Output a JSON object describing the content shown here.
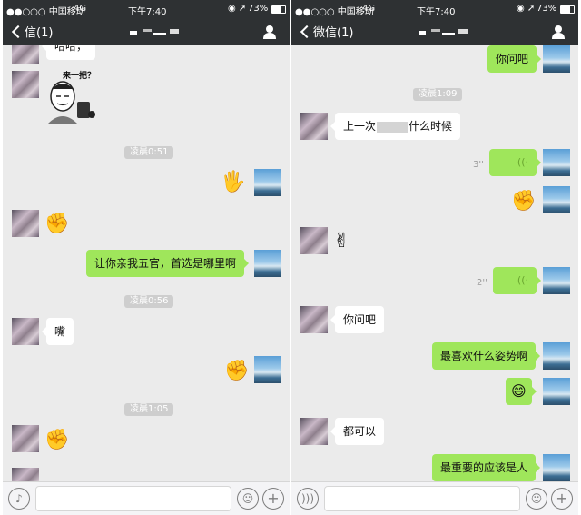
{
  "status": {
    "carrier": "●●○○○ 中国移动",
    "network": "4G",
    "time": "下午7:40",
    "battery": "73%"
  },
  "left": {
    "nav": {
      "back_label": "信(1)"
    },
    "sticker_caption": "来一把？",
    "top_partial_text": "哈哈，",
    "timestamps": [
      "凌晨0:51",
      "凌晨0:56",
      "凌晨1:05"
    ],
    "messages": {
      "m1": "让你亲我五官，首选是哪里啊",
      "m2": "嘴"
    },
    "emojis": {
      "wave": "🖐",
      "fist": "✊"
    }
  },
  "right": {
    "nav": {
      "back_label": "微信(1)"
    },
    "timestamps": [
      "凌晨1:09"
    ],
    "messages": {
      "m0": "你问吧",
      "m1": "上一次",
      "m1_tail": "什么时候",
      "m2": "你问吧",
      "m3": "最喜欢什么姿势啊",
      "m4": "都可以",
      "m5": "最重要的应该是人"
    },
    "voice": {
      "d1": "3''",
      "d2": "2''",
      "wave": "((·"
    },
    "emojis": {
      "fist": "✊",
      "victory": "✌",
      "smile": "😄"
    }
  },
  "icons": {
    "back": "chevron-left-icon",
    "user": "person-icon",
    "voice": "voice-icon",
    "emoji": "emoji-icon",
    "plus": "plus-icon"
  }
}
